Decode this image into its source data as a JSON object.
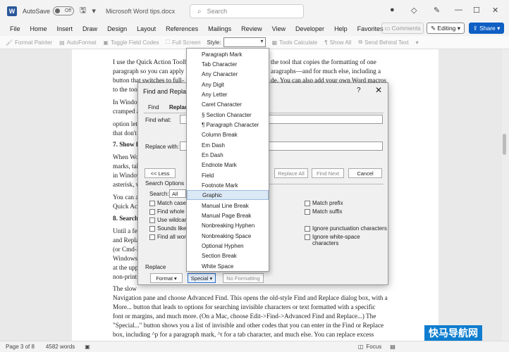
{
  "titlebar": {
    "logo": "W",
    "autosave_label": "AutoSave",
    "autosave_state": "Off",
    "title": "Microsoft Word tips.docx",
    "search_placeholder": "Search"
  },
  "menubar": {
    "items": [
      "File",
      "Home",
      "Insert",
      "Draw",
      "Design",
      "Layout",
      "References",
      "Mailings",
      "Review",
      "View",
      "Developer",
      "Help",
      "Favorites"
    ],
    "comments": "Comments",
    "editing": "Editing",
    "share": "Share"
  },
  "toolbar": {
    "items": [
      "Format Painter",
      "AutoFormat",
      "Toggle Field Codes",
      "Full Screen"
    ],
    "style_label": "Style:",
    "items2": [
      "Tools Calculate",
      "Show All",
      "Send Behind Text"
    ]
  },
  "document": {
    "lines": [
      "I use the Quick Action Toolb",
      "paragraph so you can apply",
      "button that switches to full-",
      "to the toolb",
      "In Window",
      "cramped a",
      "option let",
      "that don't",
      "7. Show h",
      "When Wo",
      "marks, tal",
      "in Window",
      "asterisk, v",
      "You can a",
      "Quick Act",
      "8. Search",
      "Until a fev",
      "and Repla",
      "(or Cmd-F",
      "Windows",
      "at the upp",
      "non-print",
      "The slow",
      "Navigation pane and choose Advanced Find. This opens the old-style Find and Replace dialog box, with a",
      "More... button that leads to options for searching invisible characters or text formatted with a specific",
      "font or margins, and much more. (On a Mac, choose Edit->Find->Advanced Find and Replace...) The",
      "\"Special...\" button shows you a list of invisible and other codes that you can enter in the Find or Replace",
      "box, including ^p for a paragraph mark, ^t for a tab character, and much else. You can replace excess",
      "paragraph marks by replacing ^p^p with ^p and repeating the operating until no excess paragraph mar"
    ],
    "right_lines": [
      "the tool that copies the formatting of one",
      "aragraphs—and for much else, including a",
      "de. You can also add your own Word macros"
    ]
  },
  "dialog": {
    "title": "Find and Replace",
    "help": "?",
    "tab_find": "Find",
    "tab_replace": "Replace",
    "find_what": "Find what:",
    "replace_with": "Replace with:",
    "less": "<< Less",
    "replace_all": "Replace All",
    "find_next": "Find Next",
    "cancel": "Cancel",
    "search_options": "Search Options",
    "search_label": "Search:",
    "search_value": "All",
    "options_left": [
      "Match case",
      "Find whole w",
      "Use wildcard",
      "Sounds like (",
      "Find all word"
    ],
    "options_right": [
      "Match prefix",
      "Match suffix",
      "Ignore punctuation characters",
      "Ignore white-space characters"
    ],
    "replace_section": "Replace",
    "format": "Format ▾",
    "special": "Special ▾",
    "no_formatting": "No Formatting"
  },
  "special_menu": {
    "items": [
      "Paragraph Mark",
      "Tab Character",
      "Any Character",
      "Any Digit",
      "Any Letter",
      "Caret Character",
      "§ Section Character",
      "¶ Paragraph Character",
      "Column Break",
      "Em Dash",
      "En Dash",
      "Endnote Mark",
      "Field",
      "Footnote Mark",
      "Graphic",
      "Manual Line Break",
      "Manual Page Break",
      "Nonbreaking Hyphen",
      "Nonbreaking Space",
      "Optional Hyphen",
      "Section Break",
      "White Space"
    ],
    "highlighted": "Graphic"
  },
  "statusbar": {
    "page": "Page 3 of 8",
    "words": "4582 words",
    "focus": "Focus"
  },
  "watermark": "快马导航网"
}
